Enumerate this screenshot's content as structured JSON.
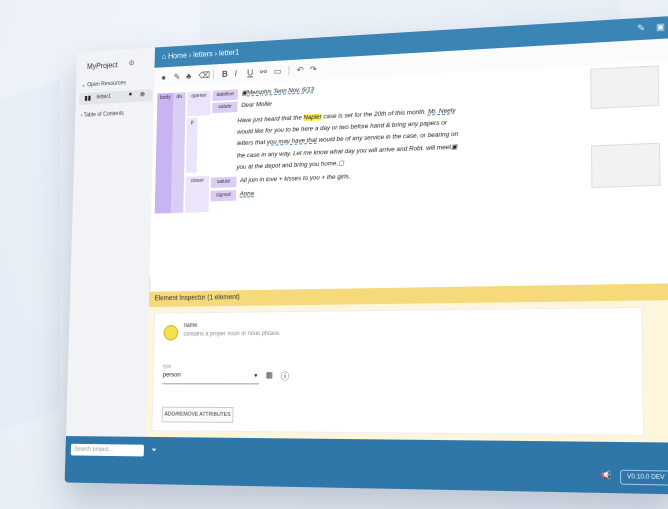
{
  "sidebar": {
    "project": "MyProject",
    "open_resources": "Open Resources",
    "resource": "letter1",
    "toc": "Table of Contents"
  },
  "header": {
    "breadcrumb": "Home › letters › letter1"
  },
  "editor": {
    "tags": {
      "body": "body",
      "div": "div",
      "opener": "opener",
      "dateline": "dateline",
      "salute": "salute",
      "p": "p",
      "closer": "closer",
      "salute2": "salute",
      "signed": "signed"
    },
    "lines": {
      "dateline": "Memphis Tenn Nov. 6/13",
      "salute": "Dear Mollie",
      "p1a": "Have just heard that the ",
      "p1hl": "Napier",
      "p1b": " case is set for the 20th of this month. ",
      "p1u": "Mr. Neely",
      "p2": "would like for you to be here a day or two before hand & bring any papers or",
      "p3a": "letters that ",
      "p3u": "you may have that",
      "p3b": " would be of any service in the case, or bearing on",
      "p4": "the case in any way. Let me know what day you will arrive and Robt. will meet",
      "p5": "you at the depot and bring you home.",
      "closer": "All join in love + kisses to you + the girls.",
      "signed": "Anna"
    }
  },
  "inspector": {
    "title": "Element Inspector (1 element)",
    "name": "name",
    "desc": "contains a proper noun or noun phrase.",
    "type_label": "type",
    "type_value": "person",
    "attr_button": "ADD/REMOVE ATTRIBUTES"
  },
  "footer": {
    "search_placeholder": "Search project...",
    "version": "V0.10.0 DEV"
  }
}
